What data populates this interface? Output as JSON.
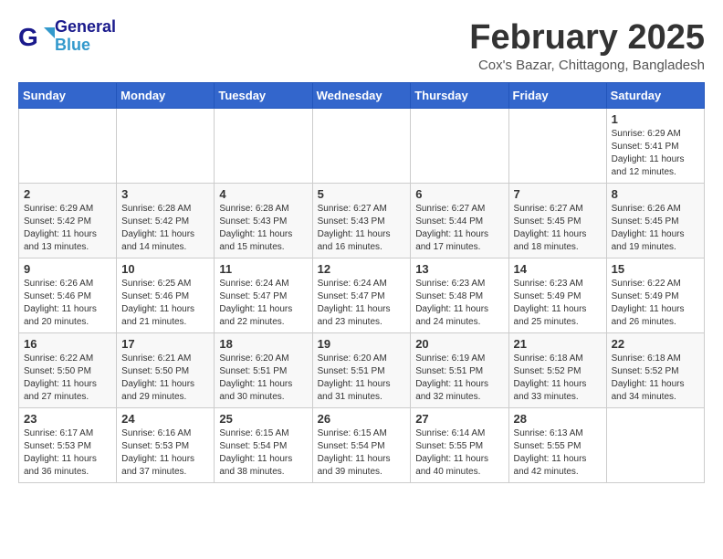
{
  "header": {
    "logo_text_general": "General",
    "logo_text_blue": "Blue",
    "month_title": "February 2025",
    "location": "Cox's Bazar, Chittagong, Bangladesh"
  },
  "days_of_week": [
    "Sunday",
    "Monday",
    "Tuesday",
    "Wednesday",
    "Thursday",
    "Friday",
    "Saturday"
  ],
  "weeks": [
    [
      {
        "day": "",
        "info": ""
      },
      {
        "day": "",
        "info": ""
      },
      {
        "day": "",
        "info": ""
      },
      {
        "day": "",
        "info": ""
      },
      {
        "day": "",
        "info": ""
      },
      {
        "day": "",
        "info": ""
      },
      {
        "day": "1",
        "info": "Sunrise: 6:29 AM\nSunset: 5:41 PM\nDaylight: 11 hours and 12 minutes."
      }
    ],
    [
      {
        "day": "2",
        "info": "Sunrise: 6:29 AM\nSunset: 5:42 PM\nDaylight: 11 hours and 13 minutes."
      },
      {
        "day": "3",
        "info": "Sunrise: 6:28 AM\nSunset: 5:42 PM\nDaylight: 11 hours and 14 minutes."
      },
      {
        "day": "4",
        "info": "Sunrise: 6:28 AM\nSunset: 5:43 PM\nDaylight: 11 hours and 15 minutes."
      },
      {
        "day": "5",
        "info": "Sunrise: 6:27 AM\nSunset: 5:43 PM\nDaylight: 11 hours and 16 minutes."
      },
      {
        "day": "6",
        "info": "Sunrise: 6:27 AM\nSunset: 5:44 PM\nDaylight: 11 hours and 17 minutes."
      },
      {
        "day": "7",
        "info": "Sunrise: 6:27 AM\nSunset: 5:45 PM\nDaylight: 11 hours and 18 minutes."
      },
      {
        "day": "8",
        "info": "Sunrise: 6:26 AM\nSunset: 5:45 PM\nDaylight: 11 hours and 19 minutes."
      }
    ],
    [
      {
        "day": "9",
        "info": "Sunrise: 6:26 AM\nSunset: 5:46 PM\nDaylight: 11 hours and 20 minutes."
      },
      {
        "day": "10",
        "info": "Sunrise: 6:25 AM\nSunset: 5:46 PM\nDaylight: 11 hours and 21 minutes."
      },
      {
        "day": "11",
        "info": "Sunrise: 6:24 AM\nSunset: 5:47 PM\nDaylight: 11 hours and 22 minutes."
      },
      {
        "day": "12",
        "info": "Sunrise: 6:24 AM\nSunset: 5:47 PM\nDaylight: 11 hours and 23 minutes."
      },
      {
        "day": "13",
        "info": "Sunrise: 6:23 AM\nSunset: 5:48 PM\nDaylight: 11 hours and 24 minutes."
      },
      {
        "day": "14",
        "info": "Sunrise: 6:23 AM\nSunset: 5:49 PM\nDaylight: 11 hours and 25 minutes."
      },
      {
        "day": "15",
        "info": "Sunrise: 6:22 AM\nSunset: 5:49 PM\nDaylight: 11 hours and 26 minutes."
      }
    ],
    [
      {
        "day": "16",
        "info": "Sunrise: 6:22 AM\nSunset: 5:50 PM\nDaylight: 11 hours and 27 minutes."
      },
      {
        "day": "17",
        "info": "Sunrise: 6:21 AM\nSunset: 5:50 PM\nDaylight: 11 hours and 29 minutes."
      },
      {
        "day": "18",
        "info": "Sunrise: 6:20 AM\nSunset: 5:51 PM\nDaylight: 11 hours and 30 minutes."
      },
      {
        "day": "19",
        "info": "Sunrise: 6:20 AM\nSunset: 5:51 PM\nDaylight: 11 hours and 31 minutes."
      },
      {
        "day": "20",
        "info": "Sunrise: 6:19 AM\nSunset: 5:51 PM\nDaylight: 11 hours and 32 minutes."
      },
      {
        "day": "21",
        "info": "Sunrise: 6:18 AM\nSunset: 5:52 PM\nDaylight: 11 hours and 33 minutes."
      },
      {
        "day": "22",
        "info": "Sunrise: 6:18 AM\nSunset: 5:52 PM\nDaylight: 11 hours and 34 minutes."
      }
    ],
    [
      {
        "day": "23",
        "info": "Sunrise: 6:17 AM\nSunset: 5:53 PM\nDaylight: 11 hours and 36 minutes."
      },
      {
        "day": "24",
        "info": "Sunrise: 6:16 AM\nSunset: 5:53 PM\nDaylight: 11 hours and 37 minutes."
      },
      {
        "day": "25",
        "info": "Sunrise: 6:15 AM\nSunset: 5:54 PM\nDaylight: 11 hours and 38 minutes."
      },
      {
        "day": "26",
        "info": "Sunrise: 6:15 AM\nSunset: 5:54 PM\nDaylight: 11 hours and 39 minutes."
      },
      {
        "day": "27",
        "info": "Sunrise: 6:14 AM\nSunset: 5:55 PM\nDaylight: 11 hours and 40 minutes."
      },
      {
        "day": "28",
        "info": "Sunrise: 6:13 AM\nSunset: 5:55 PM\nDaylight: 11 hours and 42 minutes."
      },
      {
        "day": "",
        "info": ""
      }
    ]
  ]
}
